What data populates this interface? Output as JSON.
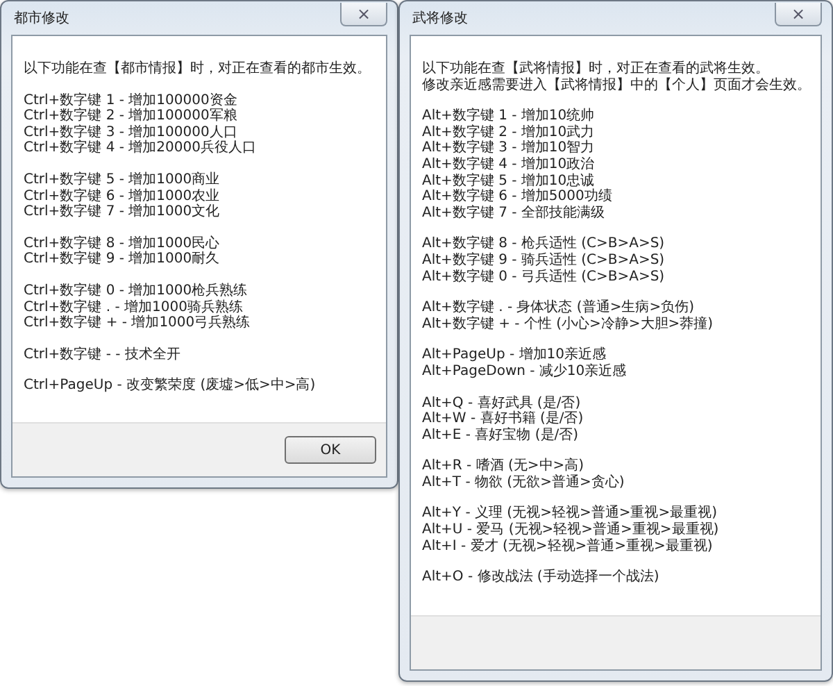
{
  "windows": [
    {
      "title": "都市修改",
      "close": "×",
      "groups": [
        {
          "lines": [
            "以下功能在查【都市情报】时，对正在查看的都市生效。"
          ]
        },
        {
          "lines": [
            "Ctrl+数字键 1 - 增加100000资金",
            "Ctrl+数字键 2 - 增加100000军粮",
            "Ctrl+数字键 3 - 增加100000人口",
            "Ctrl+数字键 4 - 增加20000兵役人口"
          ]
        },
        {
          "lines": [
            "Ctrl+数字键 5 - 增加1000商业",
            "Ctrl+数字键 6 - 增加1000农业",
            "Ctrl+数字键 7 - 增加1000文化"
          ]
        },
        {
          "lines": [
            "Ctrl+数字键 8 - 增加1000民心",
            "Ctrl+数字键 9 - 增加1000耐久"
          ]
        },
        {
          "lines": [
            "Ctrl+数字键 0 - 增加1000枪兵熟练",
            "Ctrl+数字键 . - 增加1000骑兵熟练",
            "Ctrl+数字键 + - 增加1000弓兵熟练"
          ]
        },
        {
          "lines": [
            "Ctrl+数字键 - - 技术全开"
          ]
        },
        {
          "lines": [
            "Ctrl+PageUp - 改变繁荣度 (废墟>低>中>高)"
          ]
        }
      ],
      "buttons": [
        "OK"
      ]
    },
    {
      "title": "武将修改",
      "close": "×",
      "groups": [
        {
          "lines": [
            "以下功能在查【武将情报】时，对正在查看的武将生效。",
            "修改亲近感需要进入【武将情报】中的【个人】页面才会生效。"
          ]
        },
        {
          "lines": [
            "Alt+数字键 1 - 增加10统帅",
            "Alt+数字键 2 - 增加10武力",
            "Alt+数字键 3 - 增加10智力",
            "Alt+数字键 4 - 增加10政治",
            "Alt+数字键 5 - 增加10忠诚",
            "Alt+数字键 6 - 增加5000功绩",
            "Alt+数字键 7 - 全部技能满级"
          ]
        },
        {
          "lines": [
            "Alt+数字键 8 - 枪兵适性 (C>B>A>S)",
            "Alt+数字键 9 - 骑兵适性 (C>B>A>S)",
            "Alt+数字键 0 - 弓兵适性 (C>B>A>S)"
          ]
        },
        {
          "lines": [
            "Alt+数字键 . - 身体状态 (普通>生病>负伤)",
            "Alt+数字键 + - 个性 (小心>冷静>大胆>莽撞)"
          ]
        },
        {
          "lines": [
            "Alt+PageUp - 增加10亲近感",
            "Alt+PageDown - 减少10亲近感"
          ]
        },
        {
          "lines": [
            "Alt+Q - 喜好武具 (是/否)",
            "Alt+W - 喜好书籍 (是/否)",
            "Alt+E - 喜好宝物 (是/否)"
          ]
        },
        {
          "lines": [
            "Alt+R - 嗜酒 (无>中>高)",
            "Alt+T - 物欲 (无欲>普通>贪心)"
          ]
        },
        {
          "lines": [
            "Alt+Y - 义理 (无视>轻视>普通>重视>最重视)",
            "Alt+U - 爱马 (无视>轻视>普通>重视>最重视)",
            "Alt+I - 爱才 (无视>轻视>普通>重视>最重视)"
          ]
        },
        {
          "lines": [
            "Alt+O - 修改战法 (手动选择一个战法)"
          ]
        }
      ]
    }
  ]
}
